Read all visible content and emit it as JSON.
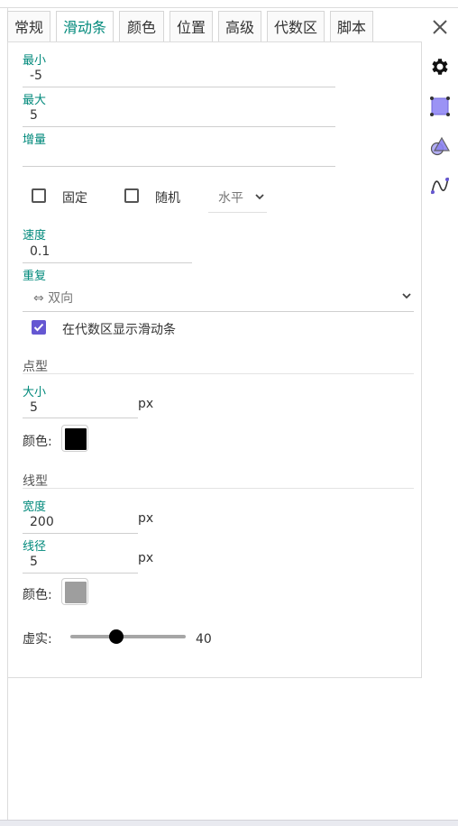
{
  "tabs": [
    {
      "label": "常规"
    },
    {
      "label": "滑动条"
    },
    {
      "label": "颜色"
    },
    {
      "label": "位置"
    },
    {
      "label": "高级"
    },
    {
      "label": "代数区"
    },
    {
      "label": "脚本"
    }
  ],
  "active_tab": "滑动条",
  "slider": {
    "min_label": "最小",
    "min_value": "-5",
    "max_label": "最大",
    "max_value": "5",
    "step_label": "增量",
    "step_value": "",
    "fixed_label": "固定",
    "fixed_checked": false,
    "random_label": "随机",
    "random_checked": false,
    "orientation_value": "水平",
    "speed_label": "速度",
    "speed_value": "0.1",
    "repeat_label": "重复",
    "repeat_value": "⇔ 双向",
    "show_in_algebra_label": "在代数区显示滑动条",
    "show_in_algebra_checked": true
  },
  "point_style": {
    "section_title": "点型",
    "size_label": "大小",
    "size_value": "5",
    "size_unit": "px",
    "color_label": "颜色:",
    "color_hex": "#000000"
  },
  "line_style": {
    "section_title": "线型",
    "width_label": "宽度",
    "width_value": "200",
    "width_unit": "px",
    "thickness_label": "线径",
    "thickness_value": "5",
    "thickness_unit": "px",
    "color_label": "颜色:",
    "color_hex": "#9e9e9e",
    "opacity_label": "虚实:",
    "opacity_value": "40",
    "opacity_fraction": 0.4
  },
  "colors": {
    "accent": "#00897b",
    "checkbox": "#6557d2",
    "icon_purple": "#8c83f0"
  },
  "side_icons": [
    "gear-icon",
    "object-square-icon",
    "shapes-icon",
    "curve-icon"
  ]
}
